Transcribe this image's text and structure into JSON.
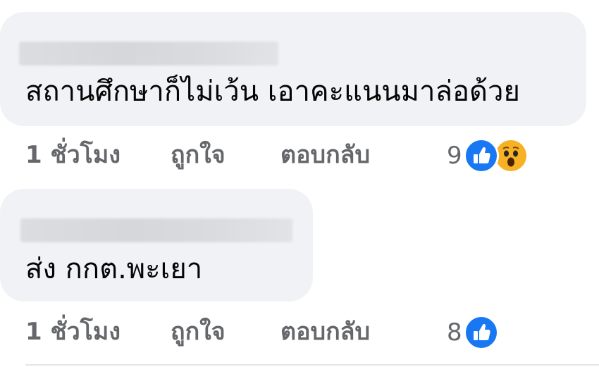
{
  "comments": [
    {
      "text": "สถานศึกษาก็ไม่เว้น เอาคะแนนมาล่อด้วย",
      "time": "1 ชั่วโมง",
      "like_label": "ถูกใจ",
      "reply_label": "ตอบกลับ",
      "reaction_count": "9",
      "reactions": [
        "like-icon",
        "wow-icon"
      ]
    },
    {
      "text": "ส่ง กกต.พะเยา",
      "time": "1 ชั่วโมง",
      "like_label": "ถูกใจ",
      "reply_label": "ตอบกลับ",
      "reaction_count": "8",
      "reactions": [
        "like-icon"
      ]
    }
  ],
  "colors": {
    "bubble": "#f0f2f5",
    "text": "#050505",
    "secondary": "#65676b",
    "like_blue": "#1877f2",
    "wow_yellow": "#f7b125"
  }
}
